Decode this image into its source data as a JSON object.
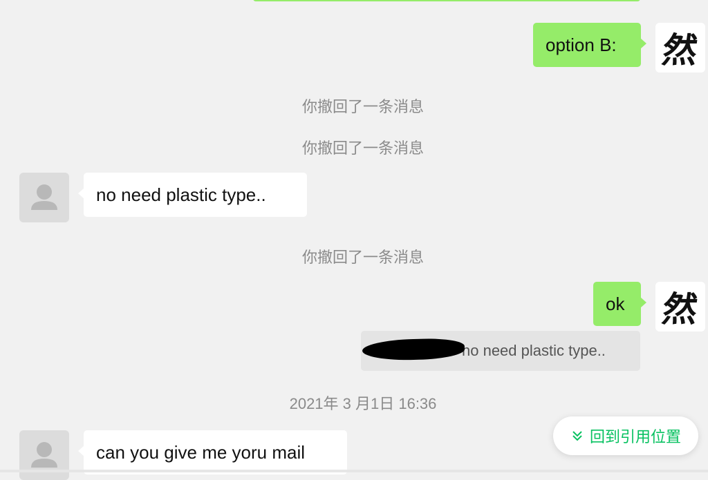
{
  "colors": {
    "outgoing_bubble": "#95ec69",
    "incoming_bubble": "#ffffff",
    "background": "#f1f1f1",
    "system_text": "#8a8a8a",
    "accent": "#07c160"
  },
  "self_avatar_char": "然",
  "messages": {
    "option_b": "option B:",
    "recalled_1": "你撤回了一条消息",
    "recalled_2": "你撤回了一条消息",
    "no_need": "no need plastic type..",
    "recalled_3": "你撤回了一条消息",
    "ok": "ok",
    "quote_text": "no need plastic type..",
    "timestamp": "2021年 3 月1日 16:36",
    "mail": "can you give me yoru mail"
  },
  "jump_button": {
    "label": "回到引用位置",
    "icon": "double-chevron-down-icon"
  }
}
